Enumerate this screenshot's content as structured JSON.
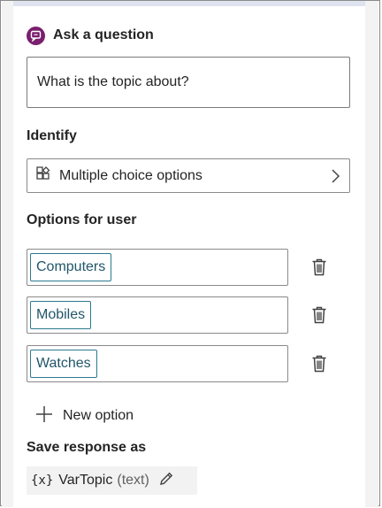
{
  "node": {
    "title": "Ask a question",
    "icon": "chat-question-icon",
    "accent_color": "#7a1f6e"
  },
  "question": {
    "text": "What is the topic about?"
  },
  "identify": {
    "label": "Identify",
    "value": "Multiple choice options",
    "icon": "multiple-choice-icon"
  },
  "options": {
    "label": "Options for user",
    "items": [
      {
        "label": "Computers"
      },
      {
        "label": "Mobiles"
      },
      {
        "label": "Watches"
      }
    ],
    "chip_color": "#2b7a8e",
    "new_option_label": "New option"
  },
  "save_response": {
    "label": "Save response as",
    "var_badge": "{x}",
    "variable_name": "VarTopic",
    "variable_type": "(text)"
  }
}
